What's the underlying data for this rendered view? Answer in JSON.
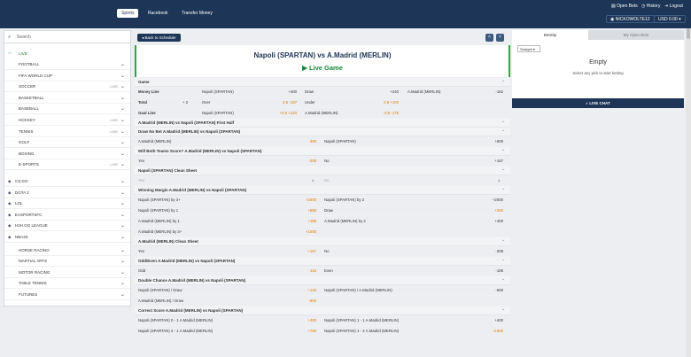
{
  "topnav": {
    "sports": "Sports",
    "racebook": "Racebook",
    "transfer_money": "Transfer Money",
    "open_bets": "Open Bets",
    "history": "History",
    "logout": "Logout",
    "username": "NICKOWOLTE12",
    "balance": "USD 0.00"
  },
  "sidebar": {
    "search_placeholder": "Search",
    "live_label": "LIVE",
    "live_items": [
      {
        "label": "FOOTBALL"
      },
      {
        "label": "FIFA WORLD CUP"
      },
      {
        "label": "SOCCER",
        "badge": "LIVE"
      },
      {
        "label": "BASKETBALL"
      },
      {
        "label": "BASEBALL"
      },
      {
        "label": "HOCKEY",
        "badge": "LIVE"
      },
      {
        "label": "TENNIS",
        "badge": "LIVE"
      },
      {
        "label": "GOLF"
      },
      {
        "label": "BOXING"
      },
      {
        "label": "E-SPORTS",
        "badge": "LIVE"
      }
    ],
    "categories": [
      {
        "label": "CS:GO"
      },
      {
        "label": "DOTA 2"
      },
      {
        "label": "LOL"
      },
      {
        "label": "EASPORTSFC"
      },
      {
        "label": "H2H GG LEAGUE"
      },
      {
        "label": "NBA2K"
      }
    ],
    "bottom_items": [
      {
        "label": "HORSE RACING"
      },
      {
        "label": "MARTIAL ARTS"
      },
      {
        "label": "MOTOR RACING"
      },
      {
        "label": "TABLE TENNIS"
      },
      {
        "label": "FUTURES"
      }
    ]
  },
  "main": {
    "back_label": "Back to Schedule",
    "match_title": "Napoli (SPARTAN) vs A.Madrid (MERLIN)",
    "live_game": "Live Game",
    "game_section": "Game",
    "game_rows": [
      {
        "label": "Money Line",
        "c1": "Napoli (SPARTAN)",
        "o1": "+400",
        "c2": "Draw",
        "o2": "+240",
        "c3": "A.Madrid (MERLIN)",
        "o3": "-162"
      },
      {
        "label": "Total",
        "extra": "+ 2",
        "c1": "Over",
        "o1": "2.5 -137",
        "c2": "Under",
        "o2": "2.5 +100"
      },
      {
        "label": "Goal Line",
        "c1": "Napoli (SPARTAN)",
        "o1": "+0.5 +120",
        "c2": "A.Madrid (MERLIN)",
        "o2": "-0.5 -175"
      }
    ],
    "first_half": "A.Madrid (MERLIN) vs Napoli (SPARTAN) First Half",
    "markets": [
      {
        "title": "Draw No Bet A.Madrid (MERLIN) vs Napoli (SPARTAN)",
        "rows": [
          [
            "A.Madrid (MERLIN)",
            "-400",
            "Napoli (SPARTAN)",
            "+600"
          ]
        ]
      },
      {
        "title": "Will Both Teams Score? A.Madrid (MERLIN) vs Napoli (SPARTAN)",
        "rows": [
          [
            "Yes",
            "-208",
            "No",
            "+167"
          ]
        ]
      },
      {
        "title": "Napoli (SPARTAN) Clean Sheet",
        "rows": [
          [
            "Yes",
            "",
            "No",
            ""
          ]
        ]
      },
      {
        "title": "Winning Margin A.Madrid (MERLIN) vs Napoli (SPARTAN)",
        "rows": [
          [
            "Napoli (SPARTAN) by 3+",
            "+2500",
            "Napoli (SPARTAN) by 2",
            "+2000"
          ],
          [
            "Napoli (SPARTAN) by 1",
            "+650",
            "Draw",
            "+260"
          ],
          [
            "A.Madrid (MERLIN) by 1",
            "+188",
            "A.Madrid (MERLIN) by 2",
            "+400"
          ],
          [
            "A.Madrid (MERLIN) by 3+",
            "+1000",
            "",
            ""
          ]
        ]
      },
      {
        "title": "A.Madrid (MERLIN) Clean Sheet",
        "rows": [
          [
            "Yes",
            "+167",
            "No",
            "-208"
          ]
        ]
      },
      {
        "title": "Odd/Even A.Madrid (MERLIN) vs Napoli (SPARTAN)",
        "rows": [
          [
            "Odd",
            "-115",
            "Even",
            "-106"
          ]
        ]
      },
      {
        "title": "Double Chance A.Madrid (MERLIN) vs Napoli (SPARTAN)",
        "rows": [
          [
            "Napoli (SPARTAN) / Draw",
            "+120",
            "Napoli (SPARTAN) / A.Madrid (MERLIN)",
            "-600"
          ],
          [
            "A.Madrid (MERLIN) / Draw",
            "-800",
            "",
            ""
          ]
        ]
      },
      {
        "title": "Correct Score A.Madrid (MERLIN) vs Napoli (SPARTAN)",
        "rows": [
          [
            "Napoli (SPARTAN) 0 - 1 A.Madrid (MERLIN)",
            "+400",
            "Napoli (SPARTAN) 1 - 1 A.Madrid (MERLIN)",
            "+400"
          ],
          [
            "Napoli (SPARTAN) 2 - 1 A.Madrid (MERLIN)",
            "+750",
            "Napoli (SPARTAN) 1 - 2 A.Madrid (MERLIN)",
            "+1800"
          ],
          [
            "",
            "",
            "",
            ""
          ]
        ]
      }
    ]
  },
  "betslip": {
    "tab_betslip": "BetSlip",
    "tab_open_bets": "My Open Bets",
    "straight": "Straight",
    "empty": "Empty",
    "empty_sub": "Select any pick to start betting",
    "live_chat": "LIVE CHAT"
  }
}
